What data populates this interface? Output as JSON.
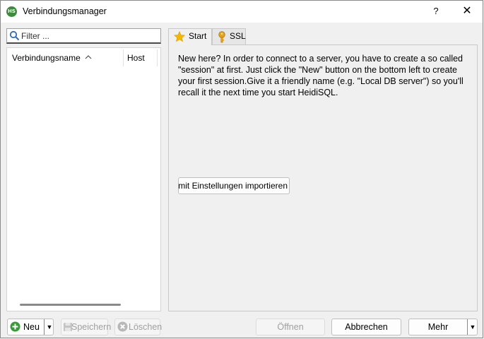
{
  "window": {
    "title": "Verbindungsmanager",
    "app_icon_text": "HS",
    "help_label": "?",
    "close_label": "✕"
  },
  "sidebar": {
    "filter_placeholder": "Filter ...",
    "columns": [
      "Verbindungsname",
      "Host"
    ],
    "sort_indicator": "^"
  },
  "tabs": [
    {
      "label": "Start",
      "icon": "star-icon",
      "active": true
    },
    {
      "label": "SSL",
      "icon": "key-icon",
      "active": false
    }
  ],
  "start_tab": {
    "intro_text": "New here? In order to connect to a server, you have to create a so called \"session\" at first. Just click the \"New\" button on the bottom left to create your first session.Give it a friendly name (e.g. \"Local DB server\") so you'll recall it the next time you start HeidiSQL.",
    "import_button_label": "Datei mit Einstellungen importieren"
  },
  "footer": {
    "new_label": "Neu",
    "save_label": "Speichern",
    "delete_label": "Löschen",
    "open_label": "Öffnen",
    "cancel_label": "Abbrechen",
    "more_label": "Mehr"
  },
  "colors": {
    "accent_green": "#3a9a3a",
    "star": "#f5b800",
    "key": "#e8a317"
  }
}
